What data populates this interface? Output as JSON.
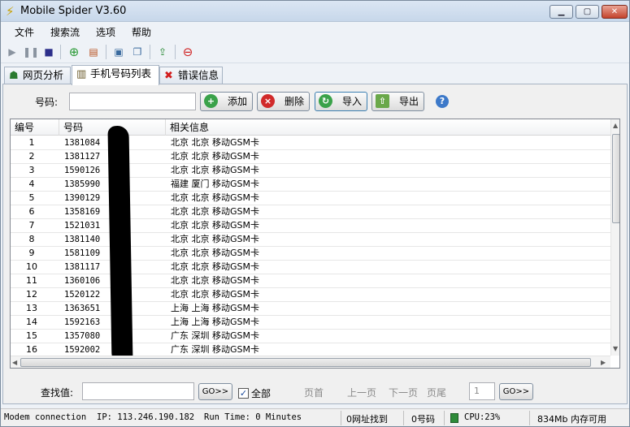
{
  "window": {
    "title": "Mobile Spider V3.60",
    "min_glyph": "▁",
    "max_glyph": "▢",
    "close_glyph": "✕"
  },
  "menu": [
    "文件",
    "搜索流",
    "选项",
    "帮助"
  ],
  "tabs": [
    {
      "label": "网页分析",
      "icon": "sitemap-icon"
    },
    {
      "label": "手机号码列表",
      "icon": "phonebook-icon"
    },
    {
      "label": "错误信息",
      "icon": "error-x-icon"
    }
  ],
  "search": {
    "label": "号码:",
    "value": ""
  },
  "buttons": {
    "add": "添加",
    "delete": "删除",
    "import": "导入",
    "export": "导出"
  },
  "table": {
    "headers": [
      "编号",
      "号码",
      "相关信息"
    ],
    "rows": [
      [
        "1",
        "1381084",
        "北京 北京 移动GSM卡"
      ],
      [
        "2",
        "1381127",
        "北京 北京 移动GSM卡"
      ],
      [
        "3",
        "1590126",
        "北京 北京 移动GSM卡"
      ],
      [
        "4",
        "1385990",
        "福建 厦门 移动GSM卡"
      ],
      [
        "5",
        "1390129",
        "北京 北京 移动GSM卡"
      ],
      [
        "6",
        "1358169",
        "北京 北京 移动GSM卡"
      ],
      [
        "7",
        "1521031",
        "北京 北京 移动GSM卡"
      ],
      [
        "8",
        "1381140",
        "北京 北京 移动GSM卡"
      ],
      [
        "9",
        "1581109",
        "北京 北京 移动GSM卡"
      ],
      [
        "10",
        "1381117",
        "北京 北京 移动GSM卡"
      ],
      [
        "11",
        "1360106",
        "北京 北京 移动GSM卡"
      ],
      [
        "12",
        "1520122",
        "北京 北京 移动GSM卡"
      ],
      [
        "13",
        "1363651",
        "上海 上海 移动GSM卡"
      ],
      [
        "14",
        "1592163",
        "上海 上海 移动GSM卡"
      ],
      [
        "15",
        "1357080",
        "广东 深圳 移动GSM卡"
      ],
      [
        "16",
        "1592002",
        "广东 深圳 移动GSM卡"
      ]
    ]
  },
  "find": {
    "label": "查找值:",
    "value": "",
    "go": "GO>>",
    "all_label": "全部",
    "all_checked": true
  },
  "pager": {
    "first": "页首",
    "prev": "上一页",
    "next": "下一页",
    "last": "页尾",
    "page": "1",
    "go": "GO>>"
  },
  "status": {
    "connection": "Modem connection",
    "ip": "IP: 113.246.190.182",
    "runtime": "Run Time: 0 Minutes",
    "urls_found": "0网址找到",
    "numbers": "0号码",
    "cpu": "CPU:23%",
    "memory": "834Mb 内存可用"
  }
}
